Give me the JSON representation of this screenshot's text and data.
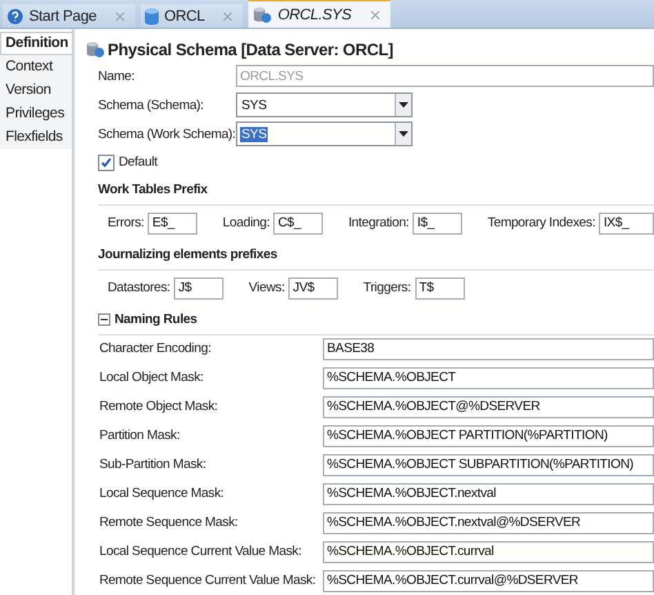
{
  "tabs": [
    {
      "label": "Start Page",
      "selected": false
    },
    {
      "label": "ORCL",
      "selected": false
    },
    {
      "label": "ORCL.SYS",
      "selected": true
    }
  ],
  "sidebar": {
    "items": [
      {
        "label": "Definition",
        "selected": true
      },
      {
        "label": "Context",
        "selected": false
      },
      {
        "label": "Version",
        "selected": false
      },
      {
        "label": "Privileges",
        "selected": false
      },
      {
        "label": "Flexfields",
        "selected": false
      }
    ]
  },
  "title": "Physical Schema [Data Server: ORCL]",
  "fields": [
    {
      "label": "Name:",
      "value": "ORCL.SYS",
      "kind": "text",
      "disabled": true
    },
    {
      "label": "Schema (Schema):",
      "value": "SYS",
      "kind": "select",
      "highlighted": false
    },
    {
      "label": "Schema (Work Schema):",
      "value": "SYS",
      "kind": "select",
      "highlighted": true
    }
  ],
  "default_checkbox": {
    "label": "Default",
    "checked": true
  },
  "sections": [
    {
      "title": "Work Tables Prefix",
      "fields": [
        {
          "label": "Errors:",
          "value": "E$_"
        },
        {
          "label": "Loading:",
          "value": "C$_"
        },
        {
          "label": "Integration:",
          "value": "I$_"
        },
        {
          "label": "Temporary Indexes:",
          "value": "IX$_"
        }
      ]
    },
    {
      "title": "Journalizing elements prefixes",
      "fields": [
        {
          "label": "Datastores:",
          "value": "J$"
        },
        {
          "label": "Views:",
          "value": "JV$"
        },
        {
          "label": "Triggers:",
          "value": "T$"
        }
      ]
    }
  ],
  "naming_rules": {
    "title": "Naming Rules",
    "expanded": true,
    "rows": [
      {
        "label": "Character Encoding:",
        "value": "BASE38"
      },
      {
        "label": "Local Object Mask:",
        "value": "%SCHEMA.%OBJECT"
      },
      {
        "label": "Remote Object Mask:",
        "value": "%SCHEMA.%OBJECT@%DSERVER"
      },
      {
        "label": "Partition Mask:",
        "value": "%SCHEMA.%OBJECT PARTITION(%PARTITION)"
      },
      {
        "label": "Sub-Partition Mask:",
        "value": "%SCHEMA.%OBJECT SUBPARTITION(%PARTITION)"
      },
      {
        "label": "Local Sequence Mask:",
        "value": "%SCHEMA.%OBJECT.nextval"
      },
      {
        "label": "Remote Sequence Mask:",
        "value": "%SCHEMA.%OBJECT.nextval@%DSERVER"
      },
      {
        "label": "Local Sequence Current Value Mask:",
        "value": "%SCHEMA.%OBJECT.currval"
      },
      {
        "label": "Remote Sequence Current Value Mask:",
        "value": "%SCHEMA.%OBJECT.currval@%DSERVER"
      }
    ]
  }
}
